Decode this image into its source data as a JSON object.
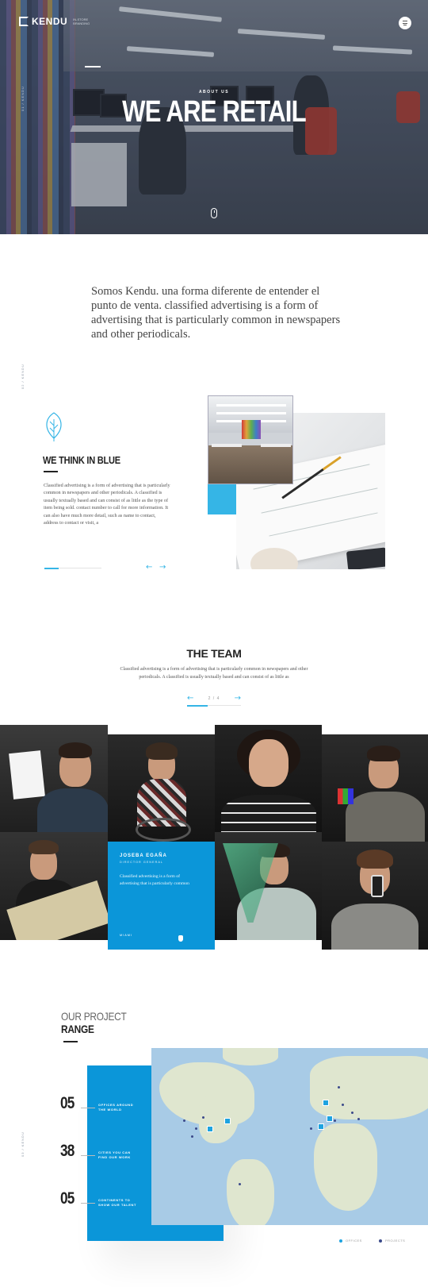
{
  "header": {
    "logo_text": "KENDU",
    "logo_tagline": "IN-STORE BRANDING",
    "menu_icon": "menu-icon"
  },
  "hero": {
    "subtitle": "ABOUT US",
    "title": "WE ARE RETAIL",
    "side_label": "01 / KENDU",
    "scroll_icon": "mouse-scroll-icon"
  },
  "intro": {
    "text": "Somos Kendu. una forma diferente de entender el punto de venta. classified advertising is a form of advertising that is particularly common in newspapers and other periodicals."
  },
  "blue_section": {
    "side_label": "02 / KENDU",
    "icon": "leaf-icon",
    "title": "WE THINK IN BLUE",
    "text": "Classified advertising is a form of advertising that is particularly common in newspapers and other periodicals. A classified is usually textually based and can consist of as little as the type of item being sold. contact number to call for more information. It can also have much more detail, such as name to contact, address to contact or visit, a",
    "prev_arrow": "←",
    "next_arrow": "→",
    "progress": 0.25
  },
  "team": {
    "title": "THE TEAM",
    "text": "Classified advertising is a form of advertising that is particularly common in newspapers and other periodicals. A classified is usually textually based and can consist of as little as",
    "pager": "2 / 4",
    "prev_arrow": "←",
    "next_arrow": "→",
    "featured": {
      "name": "JOSEBA EGAÑA",
      "role": "DIRECTOR GENERAL",
      "text": "Classified advertising is a form of advertising that is particularly common",
      "contact": "MIAMI"
    }
  },
  "projects": {
    "title_light": "OUR PROJECT",
    "title_bold": "RANGE",
    "side_label": "03 / KENDU",
    "stats": [
      {
        "value": "05",
        "label": "OFFICES AROUND THE WORLD"
      },
      {
        "value": "38",
        "label": "CITIES YOU CAN FIND OUR WORK"
      },
      {
        "value": "05",
        "label": "CONTINENTS TO SHOW OUR TALENT"
      }
    ],
    "legend": [
      {
        "label": "OFFICES",
        "color": "#1ea3e0"
      },
      {
        "label": "PROJECTS",
        "color": "#3c4a8a"
      }
    ]
  },
  "colors": {
    "accent": "#35b5e6",
    "brand_blue": "#0b96d9",
    "dark_text": "#222222"
  }
}
